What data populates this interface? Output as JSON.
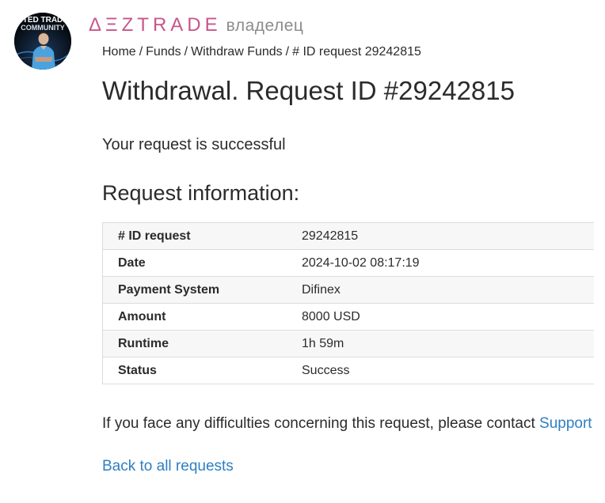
{
  "brand": {
    "logo_text": "ΔΞZTRADE",
    "role": "владелец",
    "accent_color": "#c7558a"
  },
  "avatar": {
    "caption_line1": "NITED TRADIN",
    "caption_line2": "COMMUNITY"
  },
  "breadcrumb": {
    "items": [
      "Home",
      "Funds",
      "Withdraw Funds",
      "# ID request 29242815"
    ],
    "separator": "/"
  },
  "page": {
    "title": "Withdrawal. Request ID #29242815",
    "success_message": "Your request is successful",
    "section_heading": "Request information:"
  },
  "request_info": {
    "rows": [
      {
        "label": "# ID request",
        "value": "29242815"
      },
      {
        "label": "Date",
        "value": "2024-10-02 08:17:19"
      },
      {
        "label": "Payment System",
        "value": "Difinex"
      },
      {
        "label": "Amount",
        "value": "8000 USD"
      },
      {
        "label": "Runtime",
        "value": "1h 59m"
      },
      {
        "label": "Status",
        "value": "Success"
      }
    ]
  },
  "footer": {
    "contact_text": "If you face any difficulties concerning this request, please contact",
    "support_link": "Support",
    "back_link": "Back to all requests",
    "link_color": "#2f7fc1"
  }
}
